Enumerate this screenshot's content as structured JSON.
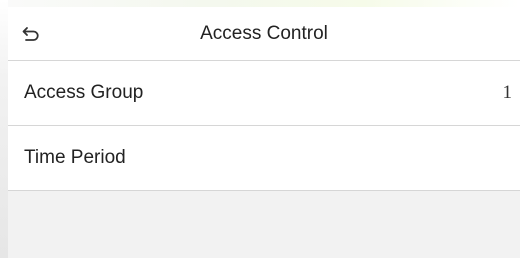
{
  "header": {
    "back_icon": "back-arrow-icon",
    "title": "Access Control"
  },
  "menu": {
    "items": [
      {
        "label": "Access Group",
        "value": "1"
      },
      {
        "label": "Time Period",
        "value": ""
      }
    ]
  }
}
